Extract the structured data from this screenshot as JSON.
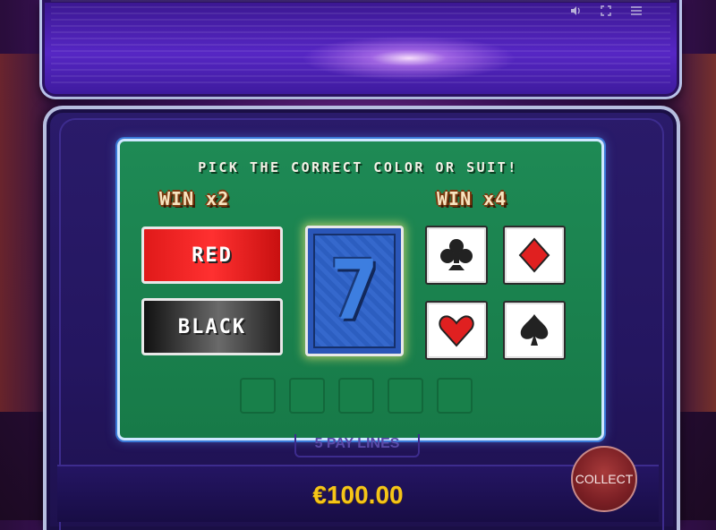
{
  "toolbar": {
    "sound_icon": "speaker-icon",
    "fullscreen_icon": "fullscreen-icon",
    "menu_icon": "hamburger-menu-icon"
  },
  "gamble": {
    "headline": "PICK THE CORRECT COLOR OR SUIT!",
    "win_color_label": "WIN x2",
    "win_suit_label": "WIN x4",
    "red_label": "RED",
    "black_label": "BLACK",
    "card_face": "7",
    "suits": [
      "club",
      "diamond",
      "heart",
      "spade"
    ],
    "history_slots": 5
  },
  "pay_lines_label": "5 PAY LINES",
  "balance": "€100.00",
  "collect_label": "COLLECT",
  "colors": {
    "board_green": "#1e8a55",
    "red": "#e01a1a",
    "gold_text": "#f5c518",
    "card_blue": "#2a56b8"
  }
}
